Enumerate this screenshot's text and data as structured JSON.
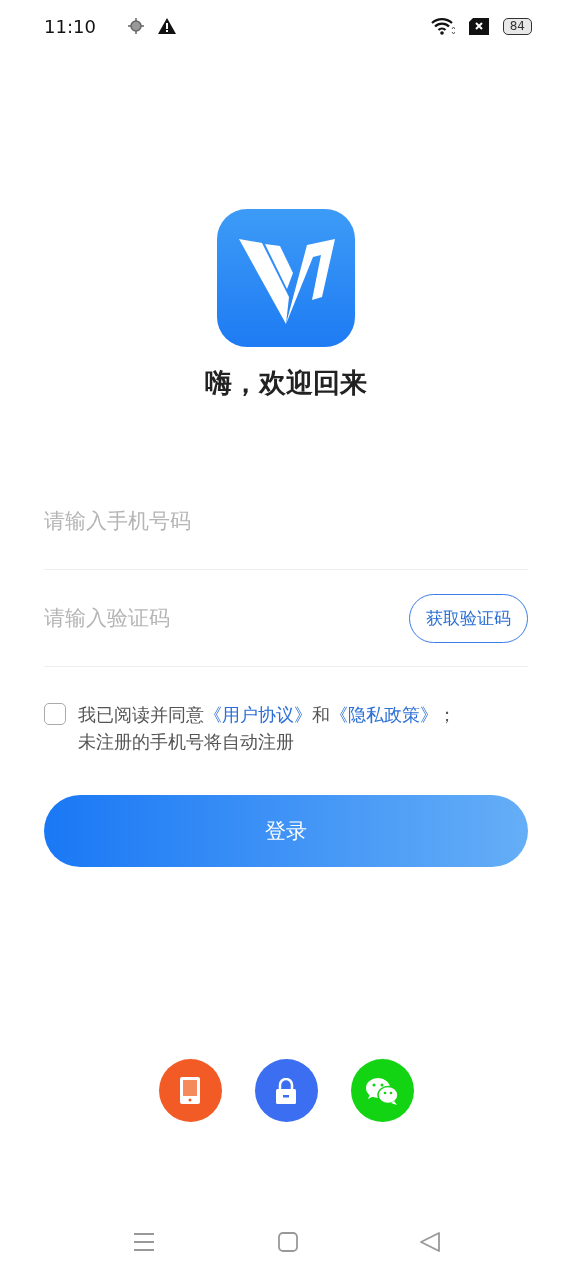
{
  "status_bar": {
    "time": "11:10",
    "battery": "84"
  },
  "welcome": "嗨，欢迎回来",
  "phone_field": {
    "placeholder": "请输入手机号码"
  },
  "code_field": {
    "placeholder": "请输入验证码"
  },
  "get_code_button": "获取验证码",
  "agreement": {
    "checked": false,
    "parts": [
      {
        "kind": "text",
        "text": "我已阅读并同意"
      },
      {
        "kind": "link",
        "text": "《用户协议》"
      },
      {
        "kind": "text",
        "text": "和"
      },
      {
        "kind": "link",
        "text": "《隐私政策》"
      },
      {
        "kind": "text",
        "text": "；"
      }
    ],
    "note": "未注册的手机号将自动注册"
  },
  "login_button": "登录",
  "login_options": [
    {
      "kind": "phone",
      "color": "#f25a26"
    },
    {
      "kind": "lock",
      "color": "#3b6ef0"
    },
    {
      "kind": "wechat",
      "color": "#12d412"
    }
  ]
}
